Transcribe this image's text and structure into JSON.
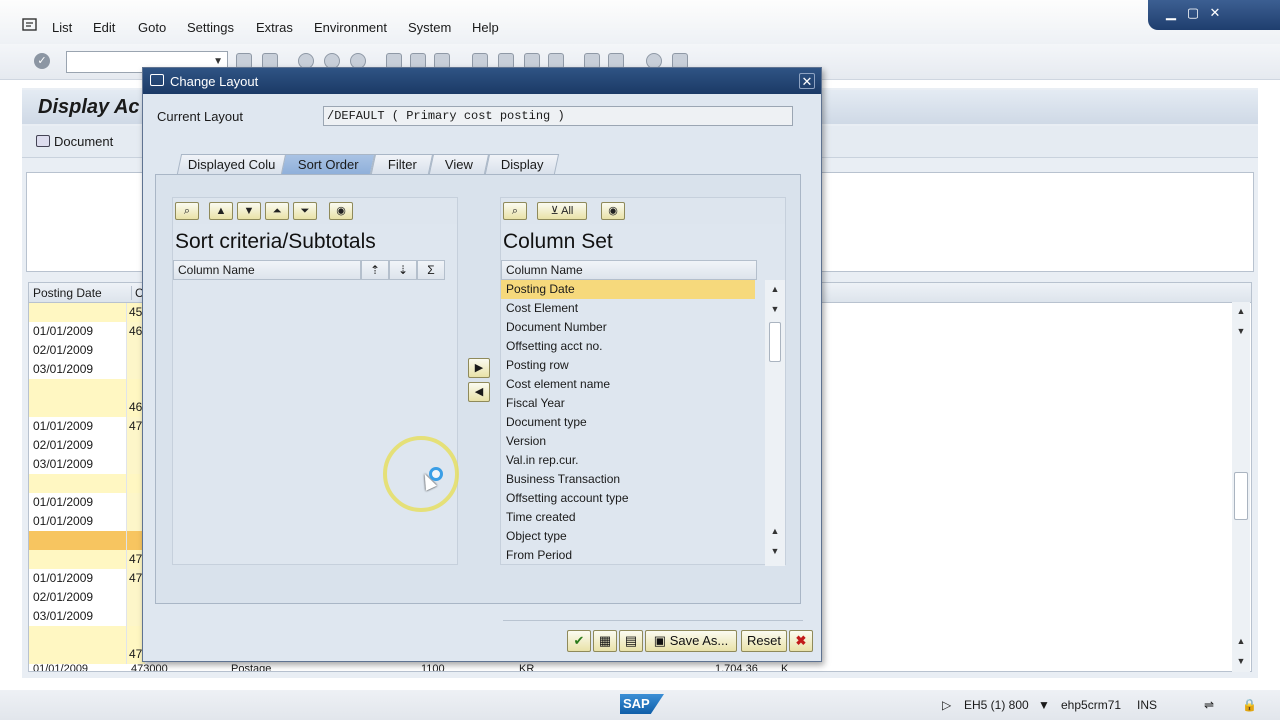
{
  "menubar": {
    "items": [
      "List",
      "Edit",
      "Goto",
      "Settings",
      "Extras",
      "Environment",
      "System",
      "Help"
    ],
    "window_controls": [
      "minimize-icon",
      "maximize-icon",
      "close-icon"
    ]
  },
  "app": {
    "title": "Display Ac",
    "toolbar_document": "Document",
    "grid": {
      "col1_header": "Posting Date",
      "col2_header": "Co",
      "rows": [
        {
          "date": "",
          "cost": "45",
          "kind": "sub"
        },
        {
          "date": "01/01/2009",
          "cost": "46",
          "kind": "normal"
        },
        {
          "date": "02/01/2009",
          "cost": "",
          "kind": "normal"
        },
        {
          "date": "03/01/2009",
          "cost": "",
          "kind": "normal"
        },
        {
          "date": "",
          "cost": "",
          "kind": "sub"
        },
        {
          "date": "",
          "cost": "46",
          "kind": "sub"
        },
        {
          "date": "01/01/2009",
          "cost": "47",
          "kind": "normal"
        },
        {
          "date": "02/01/2009",
          "cost": "",
          "kind": "normal"
        },
        {
          "date": "03/01/2009",
          "cost": "",
          "kind": "normal"
        },
        {
          "date": "",
          "cost": "",
          "kind": "sub"
        },
        {
          "date": "01/01/2009",
          "cost": "",
          "kind": "normal"
        },
        {
          "date": "01/01/2009",
          "cost": "",
          "kind": "normal"
        },
        {
          "date": "",
          "cost": "",
          "kind": "total"
        },
        {
          "date": "",
          "cost": "47",
          "kind": "sub"
        },
        {
          "date": "01/01/2009",
          "cost": "47",
          "kind": "normal"
        },
        {
          "date": "02/01/2009",
          "cost": "",
          "kind": "normal"
        },
        {
          "date": "03/01/2009",
          "cost": "",
          "kind": "normal"
        },
        {
          "date": "",
          "cost": "",
          "kind": "sub"
        },
        {
          "date": "",
          "cost": "47",
          "kind": "sub"
        }
      ],
      "last_row": {
        "date": "01/01/2009",
        "cost": "473000",
        "name": "Postage",
        "col4": "1100",
        "col5": "KR",
        "amount": "1,704.36",
        "col7": "K"
      }
    }
  },
  "status": {
    "system": "EH5 (1) 800",
    "server": "ehp5crm71",
    "mode": "INS",
    "logo": "SAP"
  },
  "dialog": {
    "title": "Change Layout",
    "current_layout_label": "Current Layout",
    "current_layout_value": "/DEFAULT ( Primary cost posting )",
    "tabs": [
      "Displayed Colu",
      "Sort Order",
      "Filter",
      "View",
      "Display"
    ],
    "active_tab": "Sort Order",
    "left": {
      "title": "Sort criteria/Subtotals",
      "column_header": "Column Name"
    },
    "right": {
      "title": "Column Set",
      "filter_label": "All",
      "column_header": "Column Name",
      "items": [
        "Posting Date",
        "Cost Element",
        "Document Number",
        "Offsetting acct no.",
        "Posting row",
        "Cost element name",
        "Fiscal Year",
        "Document type",
        "Version",
        "Val.in rep.cur.",
        "Business Transaction",
        "Offsetting account type",
        "Time created",
        "Object type",
        "From Period"
      ],
      "selected_index": 0
    },
    "buttons": {
      "save_as": "Save As...",
      "reset": "Reset"
    }
  },
  "colors": {
    "selection": "#f6d97c",
    "subtotal": "#fff7c2",
    "total": "#f7c560",
    "title_bar": "#1b3a66"
  }
}
